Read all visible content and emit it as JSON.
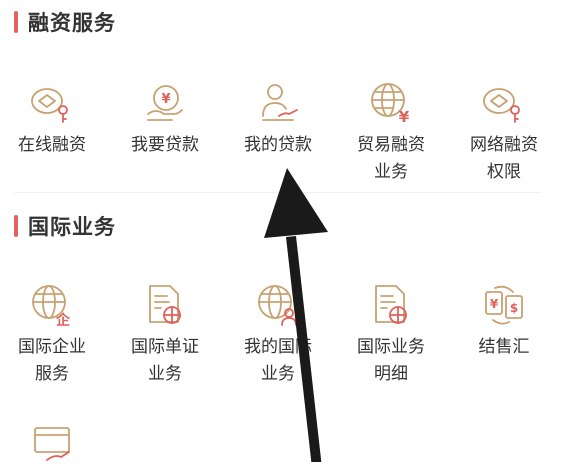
{
  "financing": {
    "title": "融资服务",
    "items": [
      {
        "line1": "在线融资",
        "line2": "",
        "icon": "coin-pin-icon"
      },
      {
        "line1": "我要贷款",
        "line2": "",
        "icon": "yen-coin-icon"
      },
      {
        "line1": "我的贷款",
        "line2": "",
        "icon": "user-hand-icon"
      },
      {
        "line1": "贸易融资",
        "line2": "业务",
        "icon": "globe-yen-icon"
      },
      {
        "line1": "网络融资",
        "line2": "权限",
        "icon": "coin-pin-icon"
      }
    ]
  },
  "international": {
    "title": "国际业务",
    "items": [
      {
        "line1": "国际企业",
        "line2": "服务",
        "icon": "globe-enterprise-icon"
      },
      {
        "line1": "国际单证",
        "line2": "业务",
        "icon": "document-globe-icon"
      },
      {
        "line1": "我的国际",
        "line2": "业务",
        "icon": "globe-user-icon"
      },
      {
        "line1": "国际业务",
        "line2": "明细",
        "icon": "document-globe-icon"
      },
      {
        "line1": "结售汇",
        "line2": "",
        "icon": "yen-dollar-exchange-icon"
      }
    ]
  },
  "extra": {
    "icon": "card-hand-icon"
  },
  "icon_glyphs": {
    "yen": "¥",
    "dollar": "$",
    "enterprise": "企"
  },
  "colors": {
    "accent": "#e8605b",
    "icon_gold": "#c7a270",
    "icon_red": "#e0605a",
    "text": "#333333"
  }
}
